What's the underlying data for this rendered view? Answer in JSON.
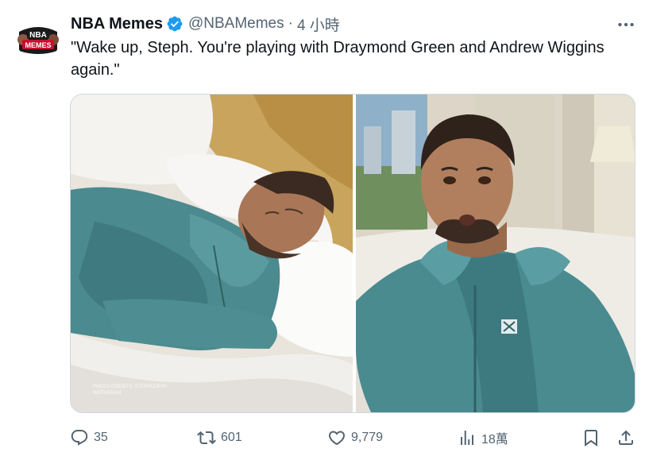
{
  "account": {
    "display_name": "NBA Memes",
    "handle": "@NBAMemes",
    "separator": "·",
    "time": "4 小時",
    "verified": true,
    "avatar_text_top": "NBA",
    "avatar_text_bottom": "MEMES"
  },
  "tweet": {
    "text": "\"Wake up, Steph. You're playing with Draymond Green and Andrew Wiggins again.\""
  },
  "media": {
    "photo_count": 2,
    "left_photo_credit_line1": "PHOTO CREDITS: STEPHCURRY",
    "left_photo_credit_line2": "INSTAGRAM"
  },
  "actions": {
    "replies": "35",
    "reposts": "601",
    "likes": "9,779",
    "views": "18萬"
  },
  "icons": {
    "verified": "verified-badge-icon",
    "more": "more-horizontal-icon",
    "reply": "reply-icon",
    "retweet": "retweet-icon",
    "like": "heart-icon",
    "views": "views-bar-chart-icon",
    "bookmark": "bookmark-icon",
    "share": "share-icon"
  },
  "colors": {
    "text_primary": "#0f1419",
    "text_secondary": "#536471",
    "verified_blue": "#1d9bf0",
    "border": "#cfd9de"
  }
}
